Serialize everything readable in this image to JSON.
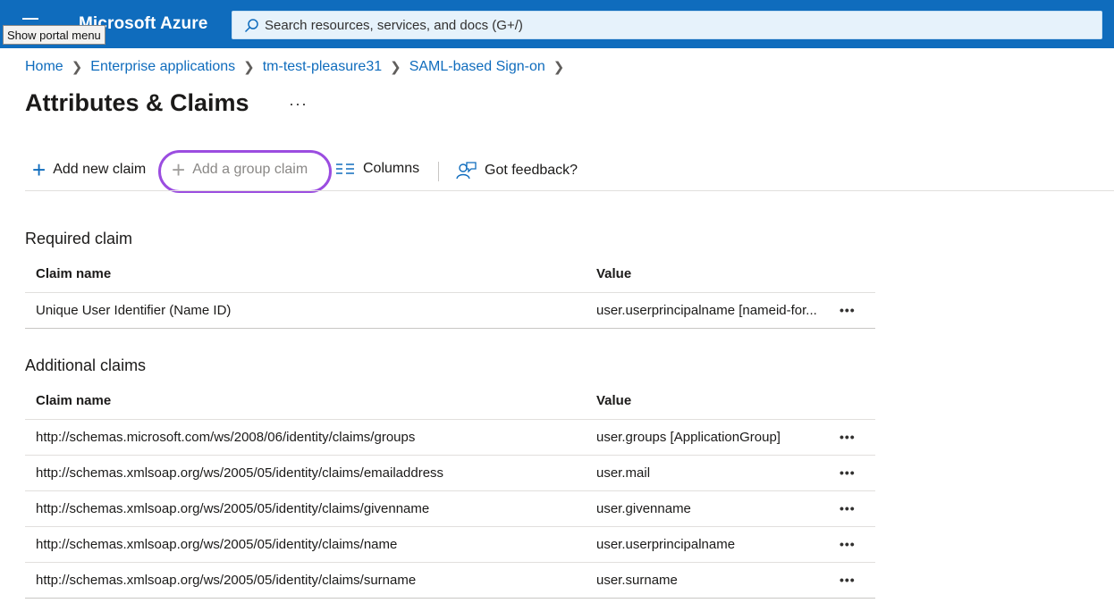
{
  "header": {
    "brand": "Microsoft Azure",
    "menu_tooltip": "Show portal menu",
    "search_placeholder": "Search resources, services, and docs (G+/)"
  },
  "breadcrumb": [
    "Home",
    "Enterprise applications",
    "tm-test-pleasure31",
    "SAML-based Sign-on"
  ],
  "page": {
    "title": "Attributes & Claims",
    "more": "···"
  },
  "toolbar": {
    "add_new_claim": "Add new claim",
    "add_group_claim": "Add a group claim",
    "columns": "Columns",
    "feedback": "Got feedback?"
  },
  "required": {
    "title": "Required claim",
    "headers": [
      "Claim name",
      "Value"
    ],
    "rows": [
      {
        "name": "Unique User Identifier (Name ID)",
        "value": "user.userprincipalname [nameid-for...",
        "more": "•••"
      }
    ]
  },
  "additional": {
    "title": "Additional claims",
    "headers": [
      "Claim name",
      "Value"
    ],
    "rows": [
      {
        "name": "http://schemas.microsoft.com/ws/2008/06/identity/claims/groups",
        "value": "user.groups [ApplicationGroup]",
        "more": "•••"
      },
      {
        "name": "http://schemas.xmlsoap.org/ws/2005/05/identity/claims/emailaddress",
        "value": "user.mail",
        "more": "•••"
      },
      {
        "name": "http://schemas.xmlsoap.org/ws/2005/05/identity/claims/givenname",
        "value": "user.givenname",
        "more": "•••"
      },
      {
        "name": "http://schemas.xmlsoap.org/ws/2005/05/identity/claims/name",
        "value": "user.userprincipalname",
        "more": "•••"
      },
      {
        "name": "http://schemas.xmlsoap.org/ws/2005/05/identity/claims/surname",
        "value": "user.surname",
        "more": "•••"
      }
    ]
  },
  "colors": {
    "topbar": "#0f6cbd",
    "link": "#0f6cbd",
    "highlight": "#9b4de0"
  }
}
